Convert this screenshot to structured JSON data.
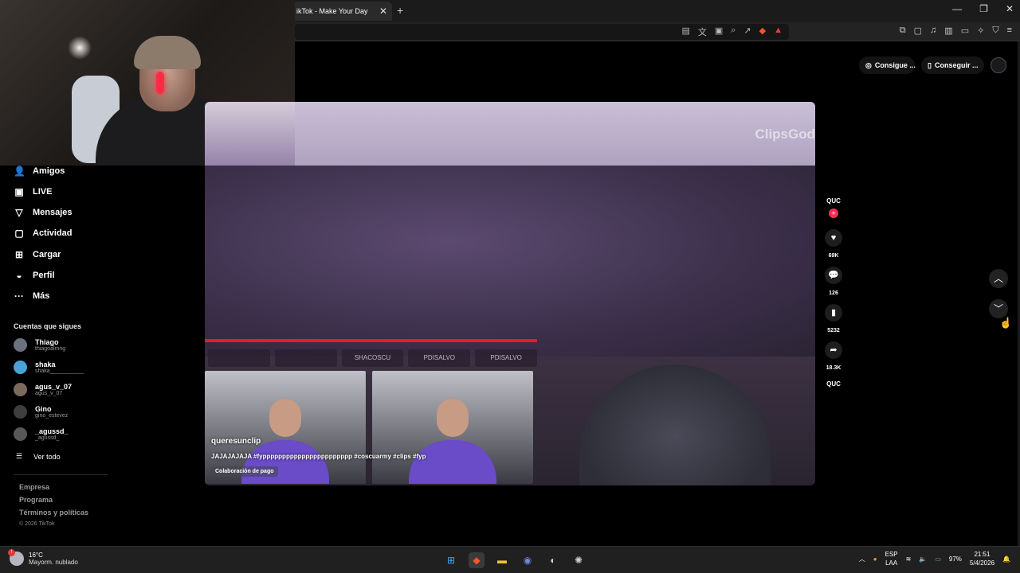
{
  "browser": {
    "tab_title": "ikTok - Make Your Day",
    "tab_close": "✕",
    "new_tab": "+",
    "win_min": "—",
    "win_max": "❐",
    "win_close": "✕"
  },
  "sidebar": {
    "nav": [
      {
        "label": "Amigos",
        "icon": "friends-icon"
      },
      {
        "label": "LIVE",
        "icon": "live-icon"
      },
      {
        "label": "Mensajes",
        "icon": "messages-icon"
      },
      {
        "label": "Actividad",
        "icon": "activity-icon"
      },
      {
        "label": "Cargar",
        "icon": "upload-icon"
      },
      {
        "label": "Perfil",
        "icon": "profile-icon"
      },
      {
        "label": "Más",
        "icon": "more-icon"
      }
    ],
    "following_header": "Cuentas que sigues",
    "following": [
      {
        "name": "Thiago",
        "handle": "thiagoalmng"
      },
      {
        "name": "shaka",
        "handle": "shaka___________"
      },
      {
        "name": "agus_v_07",
        "handle": "agus_v_07"
      },
      {
        "name": "Gino",
        "handle": "gino_estevez"
      },
      {
        "name": "_agussd_",
        "handle": "_agussd_"
      }
    ],
    "see_all": "Ver todo",
    "footer": [
      "Empresa",
      "Programa",
      "Términos y políticas"
    ],
    "copyright": "© 2026 TikTok"
  },
  "top_right": {
    "btn1": "Consigue ...",
    "btn2": "Conseguir ..."
  },
  "video": {
    "watermark": "ClipsGod",
    "author": "queresunclip",
    "description": "JAJAJAJAJA #fyppppppppppppppppppppppp #coscuarmy #clips #fyp",
    "paid_label": "Colaboración de pago",
    "stream_tags": [
      "",
      "",
      "SHACOSCU",
      "PDISALVO",
      "PDISALVO"
    ]
  },
  "rail": {
    "creator": "QUC",
    "likes": "69K",
    "comments": "126",
    "saves": "5232",
    "shares": "18.3K",
    "music": "QUC"
  },
  "taskbar": {
    "temp": "16°C",
    "weather": "Mayorm. nublado",
    "lang1": "ESP",
    "lang2": "LAA",
    "battery": "97%",
    "time": "21:51",
    "date": "5/4/2026"
  }
}
